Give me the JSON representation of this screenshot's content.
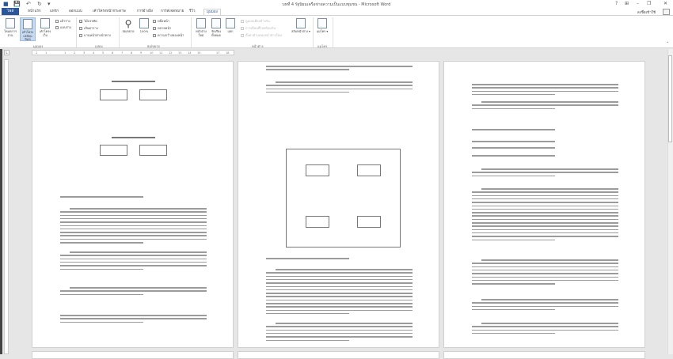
{
  "window": {
    "title": "บทที่ 4 รัฐนิยมเครือข่ายความเป็นแบบชุมชน - Microsoft Word",
    "help": "?",
    "minimize": "–",
    "restore": "❐",
    "close": "✕",
    "ribbon_options": "⊞"
  },
  "qat": {
    "save": "💾",
    "undo": "↶",
    "redo": "↻",
    "customize": "▾"
  },
  "tabs": [
    "ไฟล์",
    "หน้าแรก",
    "แทรก",
    "ออกแบบ",
    "เค้าโครงหน้ากระดาษ",
    "การอ้างอิง",
    "การส่งจดหมาย",
    "รีวิว",
    "มุมมอง"
  ],
  "active_tab": "มุมมอง",
  "account": {
    "signin": "ลงชื่อเข้าใช้"
  },
  "ribbon": {
    "views": {
      "label": "มุมมอง",
      "read_mode": "โหมดการอ่าน",
      "print_layout": "เค้าโครงเหมือนพิมพ์",
      "web_layout": "เค้าโครงเว็บ",
      "outline": "เค้าร่าง",
      "draft": "แบบร่าง"
    },
    "show": {
      "label": "แสดง",
      "ruler": "ไม้บรรทัด",
      "ruler_checked": true,
      "gridlines": "เส้นตาราง",
      "nav_pane": "บานหน้าต่างนำทาง"
    },
    "zoom": {
      "label": "ย่อ/ขยาย",
      "zoom": "ย่อ/ขยาย",
      "hundred": "100%",
      "one_page": "หนึ่งหน้า",
      "multiple_pages": "หลายหน้า",
      "page_width": "ความกว้างของหน้า"
    },
    "window": {
      "label": "หน้าต่าง",
      "new_window": "หน้าต่างใหม่",
      "arrange_all": "จัดเรียงทั้งหมด",
      "split": "แยก",
      "side_by_side": "ดูแบบเคียงข้างกัน",
      "sync_scroll": "การเลื่อนที่ไปพร้อมกัน",
      "reset_position": "ตั้งค่าตำแหน่งหน้าต่างใหม่",
      "switch_windows": "สลับหน้าต่าง ▾"
    },
    "macros": {
      "label": "แมโคร",
      "macros": "แมโคร ▾"
    }
  },
  "ruler": {
    "marks": [
      "2",
      "1",
      "",
      "1",
      "2",
      "3",
      "4",
      "5",
      "6",
      "7",
      "8",
      "9",
      "10",
      "11",
      "12",
      "13",
      "14",
      "15",
      "",
      "17",
      "18"
    ]
  }
}
